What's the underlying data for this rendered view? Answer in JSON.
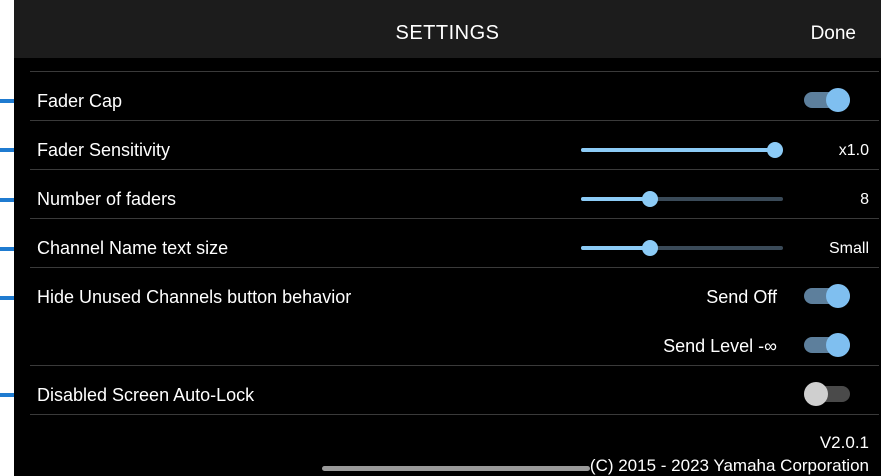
{
  "header": {
    "title": "SETTINGS",
    "done_label": "Done"
  },
  "settings": {
    "fader_cap": {
      "label": "Fader Cap",
      "enabled": true
    },
    "fader_sensitivity": {
      "label": "Fader Sensitivity",
      "value": "x1.0",
      "level": 0.96
    },
    "number_of_faders": {
      "label": "Number of faders",
      "value": "8",
      "level": 0.34
    },
    "channel_name_text_size": {
      "label": "Channel Name text size",
      "value": "Small",
      "level": 0.34
    },
    "hide_unused_channels": {
      "label": "Hide Unused Channels button behavior",
      "send_off": {
        "label": "Send Off",
        "enabled": true
      },
      "send_level": {
        "label": "Send Level -∞",
        "enabled": true
      }
    },
    "disabled_screen_auto_lock": {
      "label": "Disabled Screen Auto-Lock",
      "enabled": false
    }
  },
  "footer": {
    "version": "V2.0.1",
    "copyright": "(C) 2015 - 2023 Yamaha Corporation"
  },
  "colors": {
    "accent": "#8ccbf6",
    "toggle_on_track": "#5d7f9c",
    "toggle_off_knob": "#cfcfcf",
    "callout": "#1f7bd0",
    "background": "#000000",
    "header_bg": "#1c1c1c"
  }
}
